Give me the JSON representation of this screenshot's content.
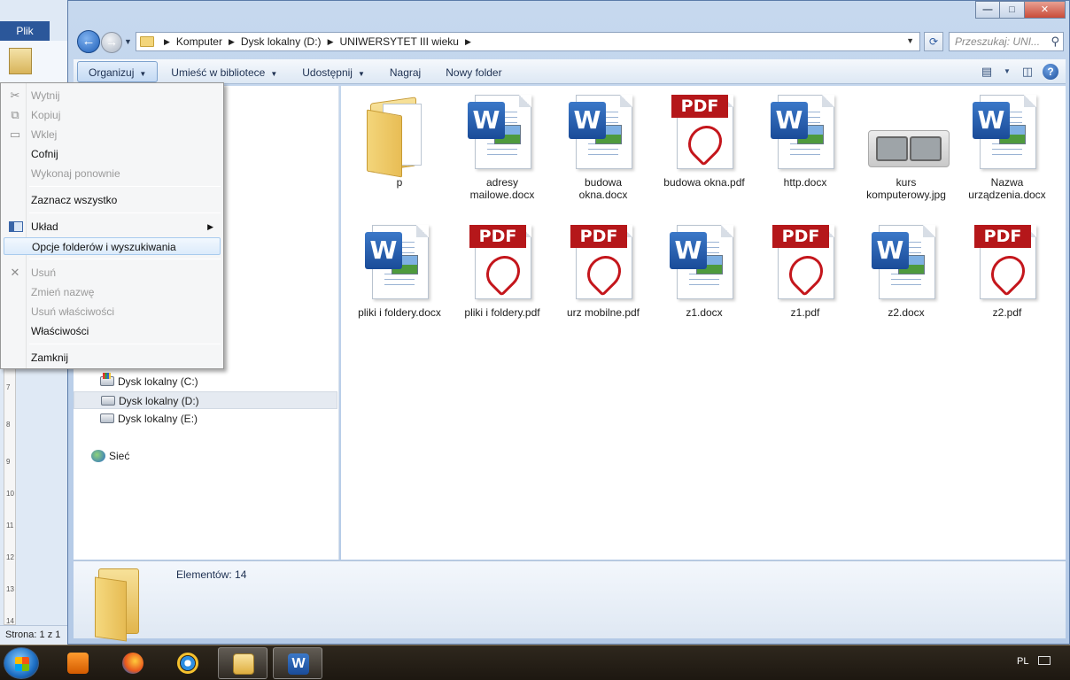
{
  "word": {
    "file_tab": "Plik",
    "status": "Strona: 1 z 1",
    "ruler_marks": [
      "7",
      "8",
      "9",
      "10",
      "11",
      "12",
      "13",
      "14"
    ]
  },
  "explorer": {
    "breadcrumb": [
      "Komputer",
      "Dysk lokalny (D:)",
      "UNIWERSYTET III wieku"
    ],
    "search_placeholder": "Przeszukaj: UNI...",
    "toolbar": {
      "organize": "Organizuj",
      "library": "Umieść w bibliotece",
      "share": "Udostępnij",
      "burn": "Nagraj",
      "new_folder": "Nowy folder"
    },
    "nav": {
      "drive_c": "Dysk lokalny (C:)",
      "drive_d": "Dysk lokalny (D:)",
      "drive_e": "Dysk lokalny (E:)",
      "network": "Sieć"
    },
    "files": [
      {
        "name": "p",
        "type": "folder"
      },
      {
        "name": "adresy mailowe.docx",
        "type": "word"
      },
      {
        "name": "budowa okna.docx",
        "type": "word"
      },
      {
        "name": "budowa okna.pdf",
        "type": "pdf"
      },
      {
        "name": "http.docx",
        "type": "word"
      },
      {
        "name": "kurs komputerowy.jpg",
        "type": "jpg"
      },
      {
        "name": "Nazwa urządzenia.docx",
        "type": "word"
      },
      {
        "name": "pliki i foldery.docx",
        "type": "word"
      },
      {
        "name": "pliki i foldery.pdf",
        "type": "pdf"
      },
      {
        "name": "urz mobilne.pdf",
        "type": "pdf"
      },
      {
        "name": "z1.docx",
        "type": "word"
      },
      {
        "name": "z1.pdf",
        "type": "pdf"
      },
      {
        "name": "z2.docx",
        "type": "word"
      },
      {
        "name": "z2.pdf",
        "type": "pdf"
      }
    ],
    "pdf_label": "PDF",
    "word_letter": "W",
    "details_count": "Elementów: 14"
  },
  "context_menu": {
    "cut": "Wytnij",
    "copy": "Kopiuj",
    "paste": "Wklej",
    "undo": "Cofnij",
    "redo": "Wykonaj ponownie",
    "select_all": "Zaznacz wszystko",
    "layout": "Układ",
    "folder_options": "Opcje folderów i wyszukiwania",
    "delete": "Usuń",
    "rename": "Zmień nazwę",
    "remove_props": "Usuń właściwości",
    "properties": "Właściwości",
    "close": "Zamknij"
  },
  "taskbar": {
    "language": "PL"
  },
  "colors": {
    "accent": "#2b579a",
    "pdf_red": "#b5171a",
    "word_blue": "#1a4b98",
    "folder_yellow": "#e8bd55"
  }
}
